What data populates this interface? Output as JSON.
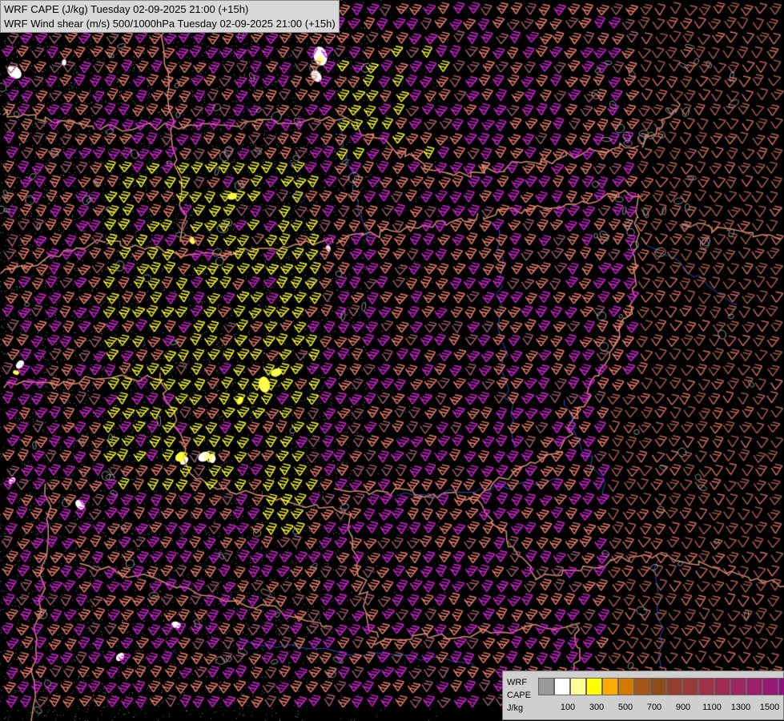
{
  "header": {
    "line1": "WRF CAPE (J/kg) Tuesday 02-09-2025 21:00 (+15h)",
    "line2": "WRF Wind shear (m/s) 500/1000hPa Tuesday 02-09-2025 21:00 (+15h)"
  },
  "legend": {
    "line1": "WRF",
    "line2": "CAPE",
    "unit": "J/kg",
    "ticks": [
      "100",
      "300",
      "500",
      "700",
      "900",
      "1100",
      "1300",
      "1500"
    ],
    "colors": [
      "#9a9a9a",
      "#ffffff",
      "#ffff99",
      "#ffff00",
      "#ffaa00",
      "#d07a00",
      "#a5551a",
      "#8e4b1a",
      "#944030",
      "#9b3a3a",
      "#a03346",
      "#a02c55",
      "#a02660",
      "#9e1f6a",
      "#981875",
      "#8e107e",
      "#86088a"
    ]
  },
  "colors": {
    "barb_magenta": "#e020e0",
    "barb_salmon": "#f08070",
    "barb_pink": "#d87060",
    "barb_yellow": "#ffff20",
    "border": "#d09070",
    "river": "#3050c0",
    "dots": "#7a7a7a"
  }
}
